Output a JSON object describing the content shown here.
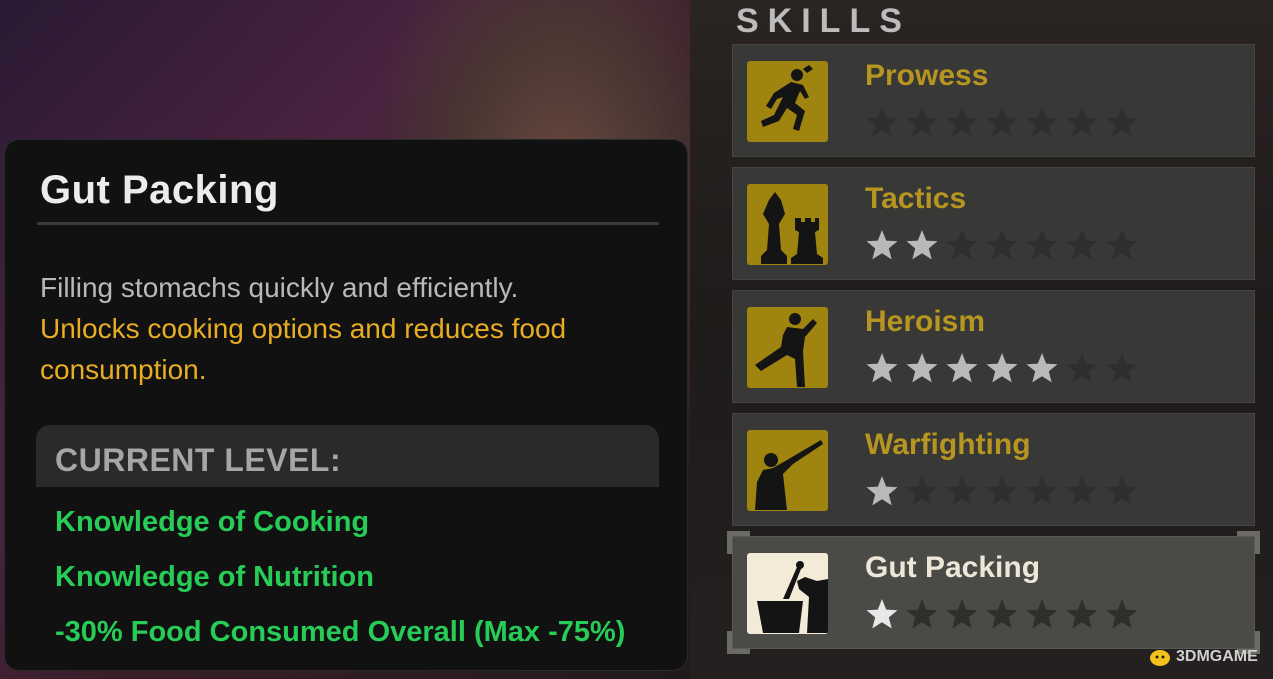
{
  "tooltip": {
    "title": "Gut Packing",
    "description": "Filling stomachs quickly and efficiently.",
    "effect_summary_line1": "Unlocks cooking options and reduces food",
    "effect_summary_line2": "consumption.",
    "current_level_label": "CURRENT LEVEL:",
    "effects": [
      "Knowledge of Cooking",
      "Knowledge of Nutrition",
      "-30% Food Consumed Overall (Max -75%)"
    ]
  },
  "skills_panel": {
    "heading": "SKILLS",
    "max_stars": 7,
    "items": [
      {
        "name": "Prowess",
        "stars": 0,
        "icon": "runner-icon",
        "selected": false
      },
      {
        "name": "Tactics",
        "stars": 2,
        "icon": "chess-pieces-icon",
        "selected": false
      },
      {
        "name": "Heroism",
        "stars": 5,
        "icon": "high-kick-icon",
        "selected": false
      },
      {
        "name": "Warfighting",
        "stars": 1,
        "icon": "rifleman-icon",
        "selected": false
      },
      {
        "name": "Gut Packing",
        "stars": 1,
        "icon": "cooking-pot-icon",
        "selected": true
      }
    ]
  },
  "watermark": "3DMGAME",
  "colors": {
    "gold_text": "#e8ad24",
    "effect_green": "#27cc57",
    "skill_name_gold": "#b69520",
    "icon_gold_bg": "#a08410",
    "star_filled": "#b9b9b9",
    "star_empty": "#2e2e2c"
  }
}
